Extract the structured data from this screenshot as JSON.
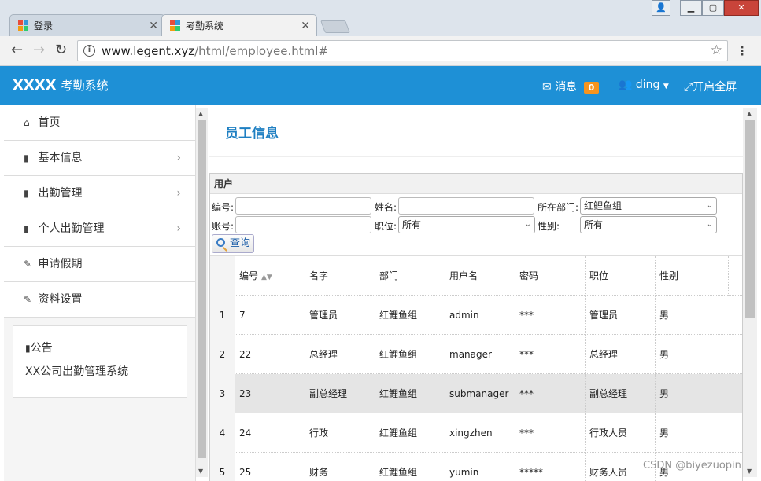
{
  "browser": {
    "tabs": [
      {
        "title": "登录",
        "active": false
      },
      {
        "title": "考勤系统",
        "active": true
      }
    ],
    "url_host": "www.legent.xyz",
    "url_path": "/html/employee.html#",
    "back_icon": "arrow-left",
    "forward_icon": "arrow-right",
    "reload_icon": "reload",
    "star_icon": "star",
    "menu_icon": "vertical-dots"
  },
  "header": {
    "brand": "XXXX",
    "brand_sub": "考勤系统",
    "messages_label": "消息",
    "messages_count": "0",
    "user_label": "ding",
    "fullscreen_label": "开启全屏",
    "colors": {
      "bar": "#1e90d6",
      "badge": "#f7941d"
    }
  },
  "sidebar": {
    "items": [
      {
        "label": "首页",
        "icon": "home-icon",
        "has_children": false
      },
      {
        "label": "基本信息",
        "icon": "file-icon",
        "has_children": true
      },
      {
        "label": "出勤管理",
        "icon": "file-icon",
        "has_children": true
      },
      {
        "label": "个人出勤管理",
        "icon": "file-icon",
        "has_children": true
      },
      {
        "label": "申请假期",
        "icon": "edit-icon",
        "has_children": false
      },
      {
        "label": "资料设置",
        "icon": "edit-icon",
        "has_children": false
      }
    ],
    "notice_title": "公告",
    "notice_text": "XX公司出勤管理系统"
  },
  "main": {
    "title": "员工信息",
    "panel_title": "用户",
    "filters": {
      "id_label": "编号:",
      "name_label": "姓名:",
      "dept_label": "所在部门:",
      "dept_value": "红鲤鱼组",
      "account_label": "账号:",
      "position_label": "职位:",
      "position_value": "所有",
      "gender_label": "性别:",
      "gender_value": "所有",
      "search_button": "查询"
    },
    "columns": [
      "编号",
      "名字",
      "部门",
      "用户名",
      "密码",
      "职位",
      "性别"
    ],
    "rows": [
      {
        "n": "1",
        "id": "7",
        "name": "管理员",
        "dept": "红鲤鱼组",
        "username": "admin",
        "password": "***",
        "position": "管理员",
        "gender": "男"
      },
      {
        "n": "2",
        "id": "22",
        "name": "总经理",
        "dept": "红鲤鱼组",
        "username": "manager",
        "password": "***",
        "position": "总经理",
        "gender": "男"
      },
      {
        "n": "3",
        "id": "23",
        "name": "副总经理",
        "dept": "红鲤鱼组",
        "username": "submanager",
        "password": "***",
        "position": "副总经理",
        "gender": "男"
      },
      {
        "n": "4",
        "id": "24",
        "name": "行政",
        "dept": "红鲤鱼组",
        "username": "xingzhen",
        "password": "***",
        "position": "行政人员",
        "gender": "男"
      },
      {
        "n": "5",
        "id": "25",
        "name": "财务",
        "dept": "红鲤鱼组",
        "username": "yumin",
        "password": "*****",
        "position": "财务人员",
        "gender": "男"
      }
    ],
    "selected_row": 2
  },
  "watermark": "CSDN @biyezuopin"
}
